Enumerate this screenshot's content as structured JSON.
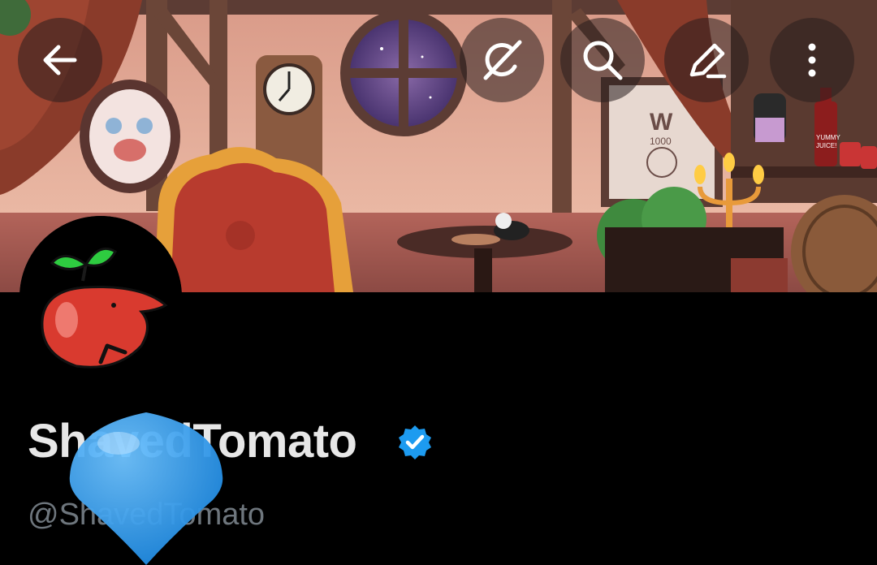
{
  "header": {
    "back_icon": "arrow-left-icon",
    "grok_icon": "grok-slash-icon",
    "search_icon": "search-icon",
    "edit_icon": "pencil-icon",
    "more_icon": "kebab-vertical-icon"
  },
  "banner": {
    "bottle_label_line1": "YUMMY",
    "bottle_label_line2": "JUICE!",
    "poster_text": "W",
    "poster_small": "1000"
  },
  "profile": {
    "display_name": "ShavedTomato",
    "handle": "@ShavedTomato",
    "verified_icon": "verified-badge-icon",
    "verified_color": "#1d9bf0"
  },
  "colors": {
    "background": "#000000",
    "name_text": "#e7e7e7",
    "handle_text": "#6e767d",
    "tomato_red": "#d93a2f",
    "sprout_green": "#2ecc40"
  }
}
